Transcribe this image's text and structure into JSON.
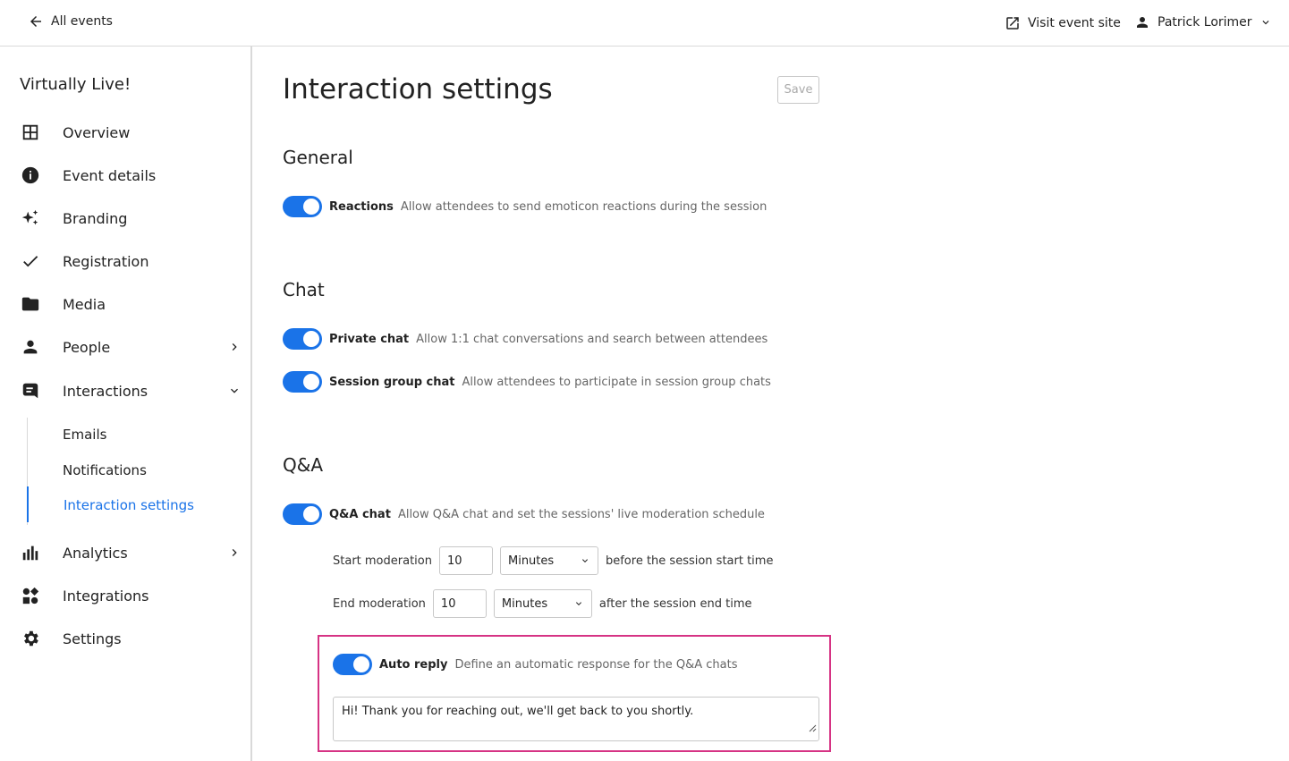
{
  "topbar": {
    "back_label": "All events",
    "visit_label": "Visit event site",
    "user_name": "Patrick Lorimer"
  },
  "sidebar": {
    "event_name": "Virtually Live!",
    "items": [
      {
        "label": "Overview",
        "icon": "grid-icon"
      },
      {
        "label": "Event details",
        "icon": "info-icon"
      },
      {
        "label": "Branding",
        "icon": "sparkles-icon"
      },
      {
        "label": "Registration",
        "icon": "check-icon"
      },
      {
        "label": "Media",
        "icon": "folder-icon"
      },
      {
        "label": "People",
        "icon": "person-icon"
      },
      {
        "label": "Interactions",
        "icon": "chat-icon"
      },
      {
        "label": "Analytics",
        "icon": "bar-chart-icon"
      },
      {
        "label": "Integrations",
        "icon": "integrations-icon"
      },
      {
        "label": "Settings",
        "icon": "gear-icon"
      }
    ],
    "sub_items": [
      {
        "label": "Emails"
      },
      {
        "label": "Notifications"
      },
      {
        "label": "Interaction settings",
        "active": true
      }
    ]
  },
  "main": {
    "title": "Interaction settings",
    "save_label": "Save",
    "sections": {
      "general": {
        "title": "General",
        "reactions": {
          "name": "Reactions",
          "desc": "Allow attendees to send emoticon reactions during the session",
          "enabled": true
        }
      },
      "chat": {
        "title": "Chat",
        "private_chat": {
          "name": "Private chat",
          "desc": "Allow 1:1 chat conversations and search between attendees",
          "enabled": true
        },
        "session_group_chat": {
          "name": "Session group chat",
          "desc": "Allow attendees to participate in session group chats",
          "enabled": true
        }
      },
      "qa": {
        "title": "Q&A",
        "qa_chat": {
          "name": "Q&A chat",
          "desc": "Allow Q&A chat and set the sessions' live moderation schedule",
          "enabled": true
        },
        "start_moderation": {
          "label": "Start moderation",
          "value": "10",
          "unit": "Minutes",
          "after": "before the session start time"
        },
        "end_moderation": {
          "label": "End moderation",
          "value": "10",
          "unit": "Minutes",
          "after": "after the session end time"
        },
        "auto_reply": {
          "name": "Auto reply",
          "desc": "Define an automatic response for the Q&A chats",
          "enabled": true,
          "message": "Hi! Thank you for reaching out, we'll get back to you shortly."
        }
      }
    }
  },
  "colors": {
    "accent": "#1a73e8",
    "highlight": "#d63384",
    "border": "#d9d9d9"
  }
}
